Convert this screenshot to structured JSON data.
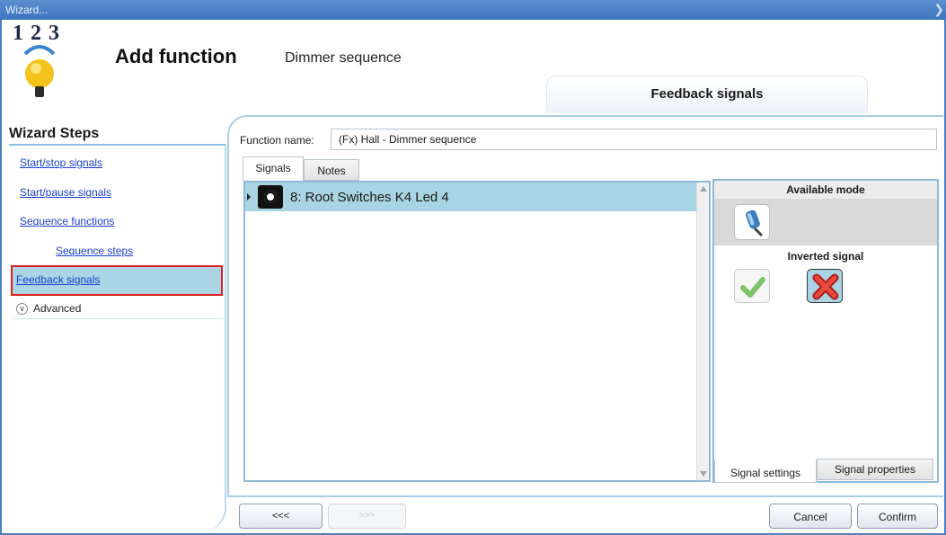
{
  "window": {
    "title": "Wizard..."
  },
  "header": {
    "logo_text": "1 2 3",
    "title": "Add function",
    "function_type": "Dimmer sequence",
    "current_step": "Feedback signals"
  },
  "sidebar": {
    "title": "Wizard Steps",
    "items": [
      {
        "label": "Start/stop signals"
      },
      {
        "label": "Start/pause signals"
      },
      {
        "label": "Sequence functions"
      },
      {
        "label": "Sequence steps"
      },
      {
        "label": "Feedback signals"
      }
    ],
    "advanced_label": "Advanced"
  },
  "form": {
    "function_name_label": "Function name:",
    "function_name_value": "(Fx) Hall - Dimmer sequence"
  },
  "tabs": [
    {
      "label": "Signals",
      "active": true
    },
    {
      "label": "Notes",
      "active": false
    }
  ],
  "signals": [
    {
      "label": "8: Root Switches K4 Led 4",
      "icon": "led-bulb-icon",
      "selected": true
    }
  ],
  "settings": {
    "available_mode_header": "Available mode",
    "mode_icon": "pushbutton-icon",
    "inverted_signal_header": "Inverted signal",
    "inverted_selected": "no",
    "tabs": [
      {
        "label": "Signal settings",
        "active": true
      },
      {
        "label": "Signal properties",
        "active": false
      }
    ]
  },
  "footer": {
    "back_label": "<<<",
    "next_label": ">>>",
    "cancel_label": "Cancel",
    "confirm_label": "Confirm"
  },
  "colors": {
    "accent_blue": "#3e74bd",
    "selection": "#a9d4e3",
    "highlight_border": "#e02020"
  }
}
